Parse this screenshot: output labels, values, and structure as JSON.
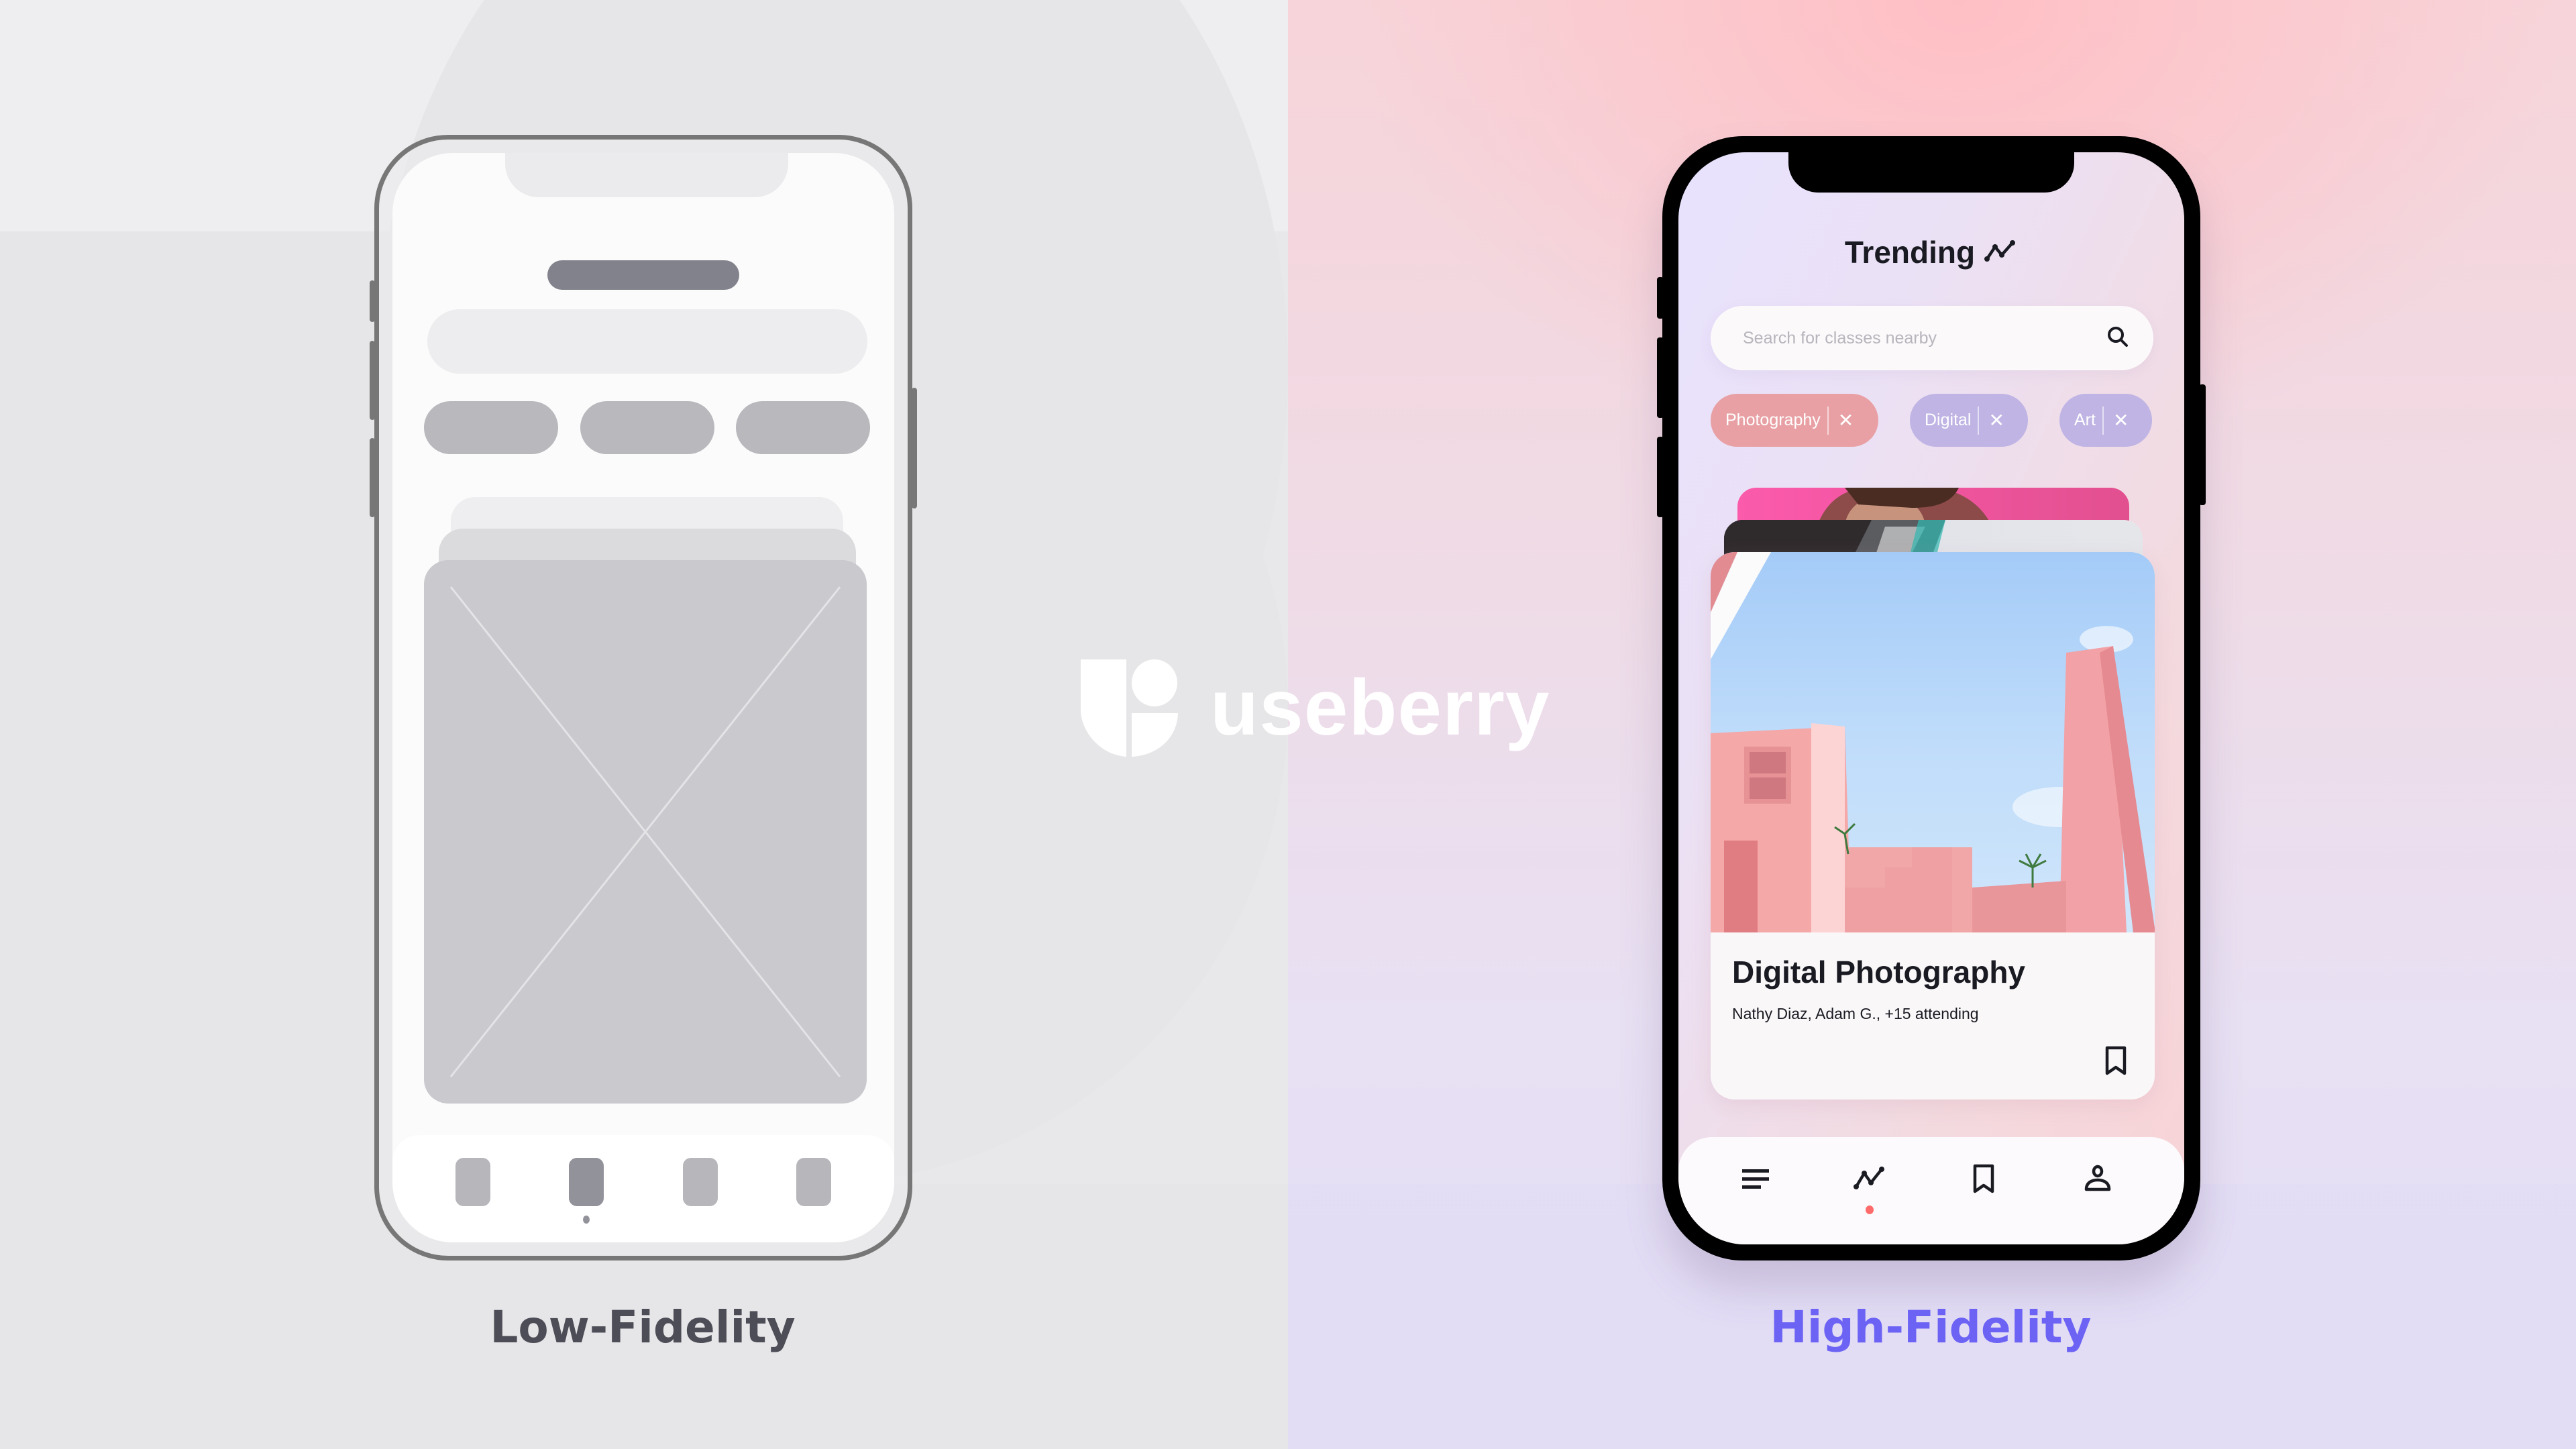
{
  "brand": {
    "name": "useberry",
    "logo_icon": "useberry-logo-icon",
    "logo_color": "#ffffff"
  },
  "captions": {
    "low_fidelity": "Low-Fidelity",
    "high_fidelity": "High-Fidelity",
    "low_color": "#4d4d57",
    "high_color": "#6c63f5"
  },
  "low_fi": {
    "chips_count": 3,
    "tabs": [
      {
        "name": "tab-1",
        "active": false
      },
      {
        "name": "tab-2",
        "active": true
      },
      {
        "name": "tab-3",
        "active": false
      },
      {
        "name": "tab-4",
        "active": false
      }
    ]
  },
  "high_fi": {
    "header": {
      "title": "Trending",
      "icon": "trending-icon"
    },
    "search": {
      "value": "",
      "placeholder": "Search for classes nearby",
      "icon": "search-icon"
    },
    "chips": [
      {
        "label": "Photography",
        "remove_icon": "close-icon",
        "color": "#e8a0a4"
      },
      {
        "label": "Digital",
        "remove_icon": "close-icon",
        "color": "#bfb4e4"
      },
      {
        "label": "Art",
        "remove_icon": "close-icon",
        "color": "#bfb4e4"
      }
    ],
    "card": {
      "title": "Digital Photography",
      "subtitle": "Nathy Diaz, Adam G., +15 attending",
      "bookmark_icon": "bookmark-icon"
    },
    "tabbar": [
      {
        "name": "menu",
        "icon": "menu-icon",
        "active": false
      },
      {
        "name": "trending",
        "icon": "trending-icon",
        "active": true
      },
      {
        "name": "saved",
        "icon": "bookmark-icon",
        "active": false
      },
      {
        "name": "profile",
        "icon": "user-icon",
        "active": false
      }
    ],
    "accent_dot_color": "#ff6a6a"
  }
}
